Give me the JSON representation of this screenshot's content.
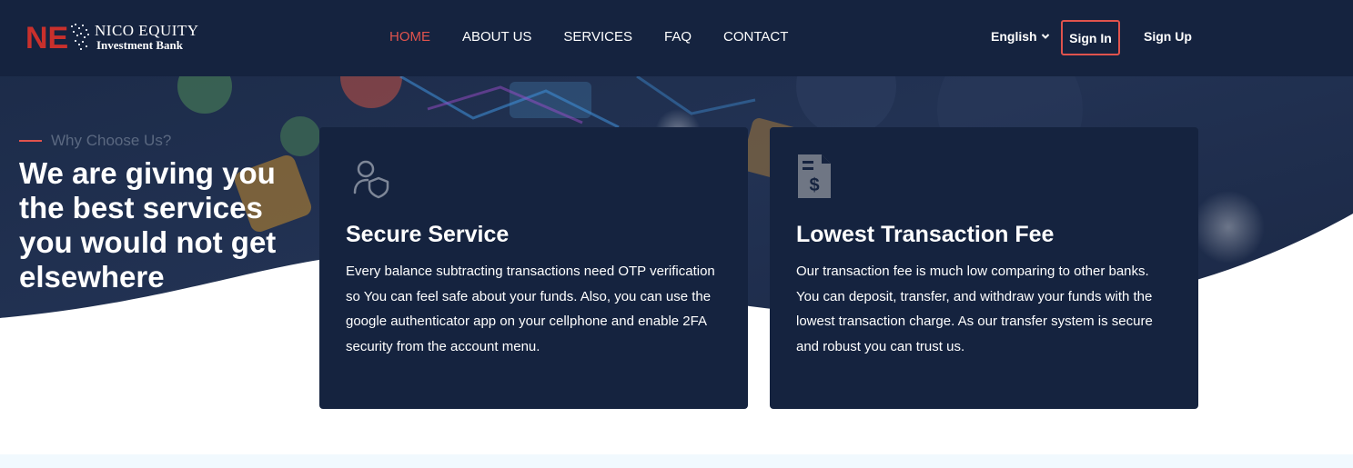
{
  "brand": {
    "logo_initials": "NE",
    "line1": "NICO EQUITY",
    "line2": "Investment Bank"
  },
  "nav": {
    "items": [
      {
        "label": "HOME",
        "active": true
      },
      {
        "label": "ABOUT US",
        "active": false
      },
      {
        "label": "SERVICES",
        "active": false
      },
      {
        "label": "FAQ",
        "active": false
      },
      {
        "label": "CONTACT",
        "active": false
      }
    ]
  },
  "header_actions": {
    "language": "English",
    "sign_in": "Sign In",
    "sign_up": "Sign Up"
  },
  "intro": {
    "eyebrow": "Why Choose Us?",
    "headline": "We are giving you the best services you would not get elsewhere"
  },
  "cards": [
    {
      "icon": "user-shield-icon",
      "title": "Secure Service",
      "text": "Every balance subtracting transactions need OTP verification so You can feel safe about your funds. Also, you can use the google authenticator app on your cellphone and enable 2FA security from the account menu."
    },
    {
      "icon": "invoice-dollar-icon",
      "title": "Lowest Transaction Fee",
      "text": "Our transaction fee is much low comparing to other banks. You can deposit, transfer, and withdraw your funds with the lowest transaction charge. As our transfer system is secure and robust you can trust us."
    }
  ],
  "colors": {
    "navy": "#15233f",
    "accent": "#e0534d",
    "muted": "#5a6880",
    "strip": "#f1f9fe"
  }
}
